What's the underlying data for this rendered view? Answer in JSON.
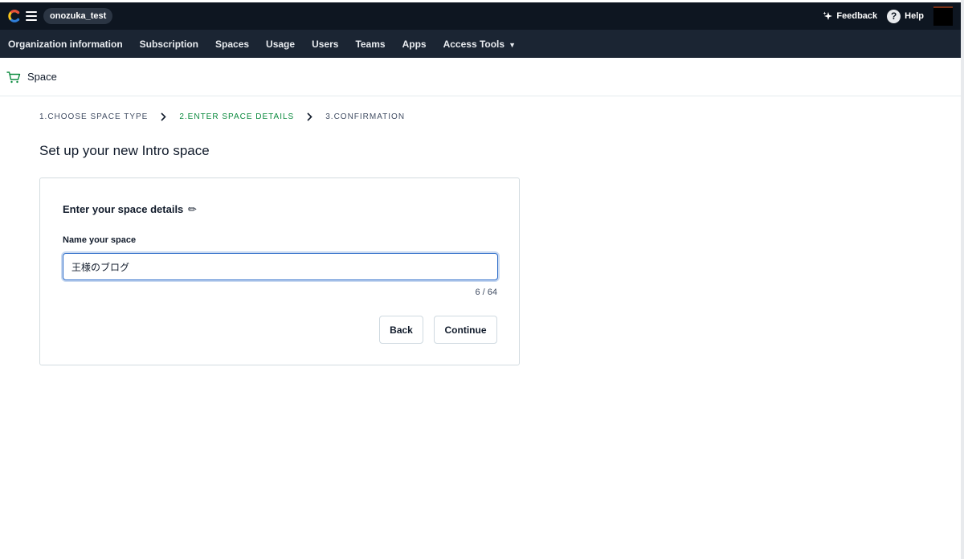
{
  "topbar": {
    "org_name": "onozuka_test",
    "feedback_label": "Feedback",
    "help_label": "Help",
    "help_glyph": "?"
  },
  "nav": {
    "items": [
      {
        "label": "Organization information"
      },
      {
        "label": "Subscription"
      },
      {
        "label": "Spaces"
      },
      {
        "label": "Usage"
      },
      {
        "label": "Users"
      },
      {
        "label": "Teams"
      },
      {
        "label": "Apps"
      },
      {
        "label": "Access Tools"
      }
    ]
  },
  "page": {
    "title": "Space"
  },
  "stepper": {
    "steps": [
      {
        "label": "1.CHOOSE SPACE TYPE"
      },
      {
        "label": "2.ENTER SPACE DETAILS"
      },
      {
        "label": "3.CONFIRMATION"
      }
    ],
    "active_index": 1
  },
  "main": {
    "heading": "Set up your new Intro space"
  },
  "card": {
    "title": "Enter your space details",
    "pencil_glyph": "✏",
    "field_label": "Name your space",
    "name_value": "王様のブログ",
    "char_count": "6 / 64",
    "back_label": "Back",
    "continue_label": "Continue"
  },
  "icons": {
    "logo": "contentful-logo-icon",
    "menu": "hamburger-menu-icon",
    "feedback": "sparkle-icon",
    "help": "question-circle-icon",
    "cart": "cart-icon",
    "chevron": "chevron-right-icon",
    "caret": "caret-down-icon"
  },
  "colors": {
    "topbar": "#0e1621",
    "navbar": "#1b2533",
    "active_step": "#0b8a3e",
    "input_focus": "#2a6ac8"
  }
}
